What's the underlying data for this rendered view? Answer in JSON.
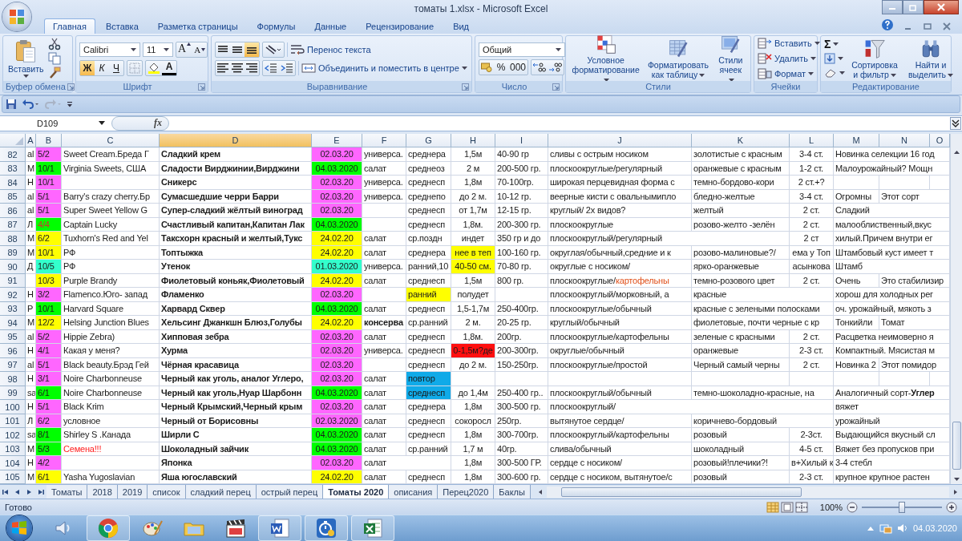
{
  "window": {
    "title": "томаты 1.xlsx - Microsoft Excel"
  },
  "ribbon_tabs": [
    {
      "label": "Главная",
      "selected": true
    },
    {
      "label": "Вставка",
      "selected": false
    },
    {
      "label": "Разметка страницы",
      "selected": false
    },
    {
      "label": "Формулы",
      "selected": false
    },
    {
      "label": "Данные",
      "selected": false
    },
    {
      "label": "Рецензирование",
      "selected": false
    },
    {
      "label": "Вид",
      "selected": false
    }
  ],
  "ribbon": {
    "clipboard": {
      "paste": "Вставить",
      "label": "Буфер обмена"
    },
    "font": {
      "name": "Calibri",
      "size": "11",
      "grow": "A",
      "shrink": "A",
      "styles": [
        {
          "glyph": "Ж",
          "on": true
        },
        {
          "glyph": "К",
          "on": false
        },
        {
          "glyph": "Ч",
          "on": false
        }
      ],
      "color_glyph": "A",
      "label": "Шрифт"
    },
    "alignment": {
      "vertical": [
        {
          "on": false
        },
        {
          "on": false
        },
        {
          "on": true
        }
      ],
      "wrap": "Перенос текста",
      "merge": "Объединить и поместить в центре",
      "label": "Выравнивание"
    },
    "number": {
      "format": "Общий",
      "percent": "%",
      "thousands": "000",
      "label": "Число"
    },
    "styles": {
      "buttons": [
        "Условное форматирование",
        "Форматировать как таблицу",
        "Стили ячеек"
      ],
      "label": "Стили"
    },
    "cells": {
      "buttons": [
        "Вставить",
        "Удалить",
        "Формат"
      ],
      "label": "Ячейки"
    },
    "editing": {
      "sum": "Σ",
      "buttons": [
        "Сортировка и фильтр",
        "Найти и выделить"
      ],
      "label": "Редактирование"
    }
  },
  "formula_bar": {
    "name_box": "D109",
    "fx": "fx"
  },
  "sheet": {
    "columns": [
      {
        "letter": "A",
        "selected": false
      },
      {
        "letter": "B",
        "selected": false
      },
      {
        "letter": "C",
        "selected": false
      },
      {
        "letter": "D",
        "selected": true,
        "bold": true
      },
      {
        "letter": "E",
        "selected": false
      },
      {
        "letter": "F",
        "selected": false
      },
      {
        "letter": "G",
        "selected": false
      },
      {
        "letter": "H",
        "selected": false
      },
      {
        "letter": "I",
        "selected": false
      },
      {
        "letter": "J",
        "selected": false
      },
      {
        "letter": "K",
        "selected": false
      },
      {
        "letter": "L",
        "selected": false
      },
      {
        "letter": "M",
        "selected": false
      },
      {
        "letter": "N",
        "selected": false
      },
      {
        "letter": "O",
        "selected": false
      }
    ],
    "rows": [
      {
        "number": "82",
        "cells": [
          "al",
          {
            "text": "5/2",
            "color": "#ff66ff"
          },
          "Sweet Cream.Бреда Г",
          "Сладкий крем",
          {
            "text": "02.03.20",
            "color": "#ff66ff"
          },
          "универса.",
          "среднера",
          "1,5м",
          "40-90 гр",
          "сливы с острым носиком",
          "золотистые с красным",
          "3-4 ст.",
          "Новинка селекции 16 год",
          ""
        ]
      },
      {
        "number": "83",
        "cells": [
          "M",
          {
            "text": "10/1",
            "color": "#00ff00"
          },
          "Virginia Sweets, США",
          "Сладости Вирджинии,Вирджини",
          {
            "text": "04.03.2020",
            "color": "#00ff00"
          },
          "салат",
          "среднеоз",
          "2 м",
          "200-500 гр.",
          "плоскоокруглые/регулярный",
          "оранжевые с красным",
          "1-2 ст.",
          "Малоурожайный? Мощн",
          ""
        ]
      },
      {
        "number": "84",
        "cells": [
          "H",
          {
            "text": "10/1",
            "color": "#ff66ff"
          },
          "",
          "Сникерс",
          {
            "text": "02.03.20",
            "color": "#ff66ff"
          },
          "универса.",
          "среднесп",
          "1,8м",
          "70-100гр.",
          "широкая перцевидная форма с",
          "темно-бордово-кори",
          "2 ст.+?",
          "",
          ""
        ]
      },
      {
        "number": "85",
        "cells": [
          "al",
          {
            "text": "5/1",
            "color": "#ff66ff"
          },
          "Barry's crazy cherry.Бр",
          "Сумасшедшие черри Барри",
          {
            "text": "02.03.20",
            "color": "#ff66ff"
          },
          "универса.",
          "среднепо",
          "до 2 м.",
          "10-12 гр.",
          "веерные кисти с овальнымипло",
          "бледно-желтые",
          "3-4 ст.",
          "Огромны",
          "Этот сорт"
        ]
      },
      {
        "number": "86",
        "cells": [
          "al",
          {
            "text": "5/1",
            "color": "#ff66ff"
          },
          "Super Sweet Yellow G",
          "Супер-сладкий жёлтый виноград",
          {
            "text": "02.03.20",
            "color": "#ff66ff"
          },
          "",
          "среднесп",
          "от 1,7м",
          "12-15 гр.",
          "круглый/ 2х видов?",
          "желтый",
          "2 ст.",
          "Сладкий",
          ""
        ]
      },
      {
        "number": "87",
        "cells": [
          "Л",
          {
            "text": "4/4",
            "color": "#00ff00",
            "ink": {
              "color": "#d03030"
            }
          },
          "Captain Lucky",
          "Счастливый капитан,Капитан Лак",
          {
            "text": "04.03.2020",
            "color": "#00ff00"
          },
          "",
          "среднесп",
          "1,8м.",
          "200-300 гр.",
          "плоскоокруглые",
          "розово-желто -зелён",
          "2 ст.",
          "малооблиственный,вкус",
          ""
        ]
      },
      {
        "number": "88",
        "cells": [
          "M",
          {
            "text": "6/2",
            "color": "#ffff00"
          },
          "Tuxhorn's Red and Yel",
          "Таксхорн красный и желтый,Тукс",
          {
            "text": "24.02.20",
            "color": "#ffff00"
          },
          "салат",
          "ср.поздн",
          "индет",
          "350 гр и до",
          "плоскоокруглый/регулярный",
          "",
          "2 ст",
          "хилый.Причем внутри ег",
          ""
        ]
      },
      {
        "number": "89",
        "cells": [
          "M",
          {
            "text": "10/1",
            "color": "#ffff00"
          },
          "РФ",
          "Топтыжка",
          {
            "text": "24.02.20",
            "color": "#ffff00"
          },
          "салат",
          "среднера",
          {
            "text": "нее в теп",
            "color": "#ffff00"
          },
          "100-160 гр.",
          "округлая/обычный,средние и к",
          "розово-малиновые?/",
          "ема у Топ",
          "Штамбовый куст имеет т",
          ""
        ]
      },
      {
        "number": "90",
        "cells": [
          "Д",
          {
            "text": "10/5",
            "color": "#33ffcc"
          },
          "РФ",
          "Утенок",
          {
            "text": "01.03.2020",
            "color": "#33ffcc"
          },
          "универса.",
          "ранний,10",
          {
            "text": "40-50 см.",
            "color": "#ffff00"
          },
          "70-80 гр.",
          "округлые с носиком/",
          "ярко-оранжевые",
          "асынкова",
          "Штамб",
          ""
        ]
      },
      {
        "number": "91",
        "cells": [
          "",
          {
            "text": "10/3",
            "color": "#ffff00"
          },
          "Purple Brandy",
          "Фиолетовый коньяк,Фиолетовый",
          {
            "text": "24.02.20",
            "color": "#ffff00"
          },
          "салат",
          "среднесп",
          "1,5м",
          "800 гр.",
          {
            "runs": [
              {
                "text": "плоскоокруглые/"
              },
              {
                "text": "картофельны",
                "color": "#e0501a"
              }
            ]
          },
          "темно-розового  цвет",
          "2 ст.",
          "Очень",
          "Это стабилизир"
        ]
      },
      {
        "number": "92",
        "cells": [
          "H",
          {
            "text": "3/2",
            "color": "#ff66ff"
          },
          "Flamenco.Юго- запад",
          "Фламенко",
          {
            "text": "02.03.20",
            "color": "#ff66ff"
          },
          "",
          {
            "text": "ранний",
            "color": "#ffff00"
          },
          "полудет",
          "",
          "плоскоокруглый/морковный, а",
          "красные",
          "",
          "хорош для холодных рег",
          ""
        ]
      },
      {
        "number": "93",
        "cells": [
          "P",
          {
            "text": "10/1",
            "color": "#00ff00"
          },
          "Harvard Square",
          "Харвард Сквер",
          {
            "text": "04.03.2020",
            "color": "#00ff00"
          },
          "салат",
          "среднесп",
          "1,5-1,7м",
          "250-400гр.",
          "плоскоокруглые/обычный",
          "красные с зелеными полосками",
          "",
          "оч. урожайный, мякоть з",
          ""
        ]
      },
      {
        "number": "94",
        "cells": [
          "M",
          {
            "text": "12/2",
            "color": "#ffff00"
          },
          "Helsing Junction Blues",
          "Хельсинг Джанкшн Блюз,Голубы",
          {
            "text": "24.02.20",
            "color": "#ffff00"
          },
          {
            "text": "консерва",
            "bold": true
          },
          "ср.ранний",
          "2 м.",
          "20-25 гр.",
          "круглый/обычный",
          "фиолетовые, почти черные с кр",
          "",
          "Тонкийли",
          "Томат"
        ]
      },
      {
        "number": "95",
        "cells": [
          "al",
          {
            "text": "5/2",
            "color": "#ff66ff"
          },
          "Hippie Zebra)",
          "Хипповая зебра",
          {
            "text": "02.03.20",
            "color": "#ff66ff"
          },
          "салат",
          "среднесп",
          "1,8м.",
          "200гр.",
          "плоскоокруглые/картофельны",
          "зеленые с красными",
          "2 ст.",
          "Расцветка неимоверно я",
          ""
        ]
      },
      {
        "number": "96",
        "cells": [
          "H",
          {
            "text": "4/1",
            "color": "#ff66ff"
          },
          "Какая у меня?",
          "Хурма",
          {
            "text": "02.03.20",
            "color": "#ff66ff"
          },
          "универса.",
          "среднесп",
          {
            "text": "0-1,5м?де",
            "color": "#ff1010"
          },
          "200-300гр.",
          "округлые/обычный",
          "оранжевые",
          "2-3 ст.",
          "Компактный. Мясистая м",
          ""
        ]
      },
      {
        "number": "97",
        "cells": [
          "al",
          {
            "text": "5/1",
            "color": "#ff66ff"
          },
          "Black beauty.Брэд Гей",
          "Чёрная красавица",
          {
            "text": "02.03.20",
            "color": "#ff66ff"
          },
          "",
          "среднесп",
          "до 2 м.",
          "150-250гр.",
          "плоскоокруглые/простой",
          "Черный самый черны",
          "2 ст.",
          "Новинка 2",
          "Этот помидор"
        ]
      },
      {
        "number": "98",
        "cells": [
          "H",
          {
            "text": "3/1",
            "color": "#ff66ff"
          },
          "Noire Charbonneuse",
          "Черный как уголь, аналог Углеро,",
          {
            "text": "02.03.20",
            "color": "#ff66ff"
          },
          "салат",
          {
            "text": "повтор",
            "color": "#10aae8"
          },
          "",
          "",
          "",
          "",
          "",
          "",
          ""
        ]
      },
      {
        "number": "99",
        "cells": [
          "sa",
          {
            "text": "6/1",
            "color": "#00ff00"
          },
          "Noire Charbonneuse",
          "Черный как уголь,Нуар Шарбонн",
          {
            "text": "04.03.2020",
            "color": "#00ff00"
          },
          "салат",
          {
            "text": "среднесп",
            "color": "#10aae8"
          },
          "до 1,4м",
          "250-400 гр..",
          "плоскоокруглый/обычный",
          "темно-шоколадно-красные, на",
          "",
          "Аналогичный сорт-**Углер**",
          ""
        ]
      },
      {
        "number": "100",
        "cells": [
          "H",
          {
            "text": "5/1",
            "color": "#ff66ff"
          },
          "Black Krim",
          "Черный Крымский,Черный крым",
          {
            "text": "02.03.20",
            "color": "#ff66ff"
          },
          "салат",
          "среднера",
          "1,8м",
          "300-500 гр.",
          "плоскоокруглый/",
          "",
          "",
          "вяжет",
          ""
        ]
      },
      {
        "number": "101",
        "cells": [
          "Л",
          {
            "text": "6/2",
            "color": "#ff66ff"
          },
          "условное",
          "Черный от Борисовны",
          {
            "text": "02.03.2020",
            "color": "#ff66ff"
          },
          "салат",
          "среднесп",
          "сокоросл",
          "250гр.",
          "вытянутое сердце/",
          "коричнево-бордовый",
          "",
          "урожайный",
          ""
        ]
      },
      {
        "number": "102",
        "cells": [
          "sa",
          {
            "text": "8/1",
            "color": "#00ff00"
          },
          "Shirley S .Канада",
          "Ширли С",
          {
            "text": "04.03.2020",
            "color": "#00ff00"
          },
          "салат",
          "среднесп",
          "1,8м",
          "300-700гр.",
          "плоскоокруглый/картофельны",
          "розовый",
          "2-3ст.",
          "Выдающийся вкусный сл",
          ""
        ]
      },
      {
        "number": "103",
        "cells": [
          "M",
          {
            "text": "5/3",
            "color": "#00ff00"
          },
          {
            "text": "Семена!!!",
            "ink": {
              "color": "#ff2020"
            }
          },
          "Шоколадный зайчик",
          {
            "text": "04.03.2020",
            "color": "#00ff00"
          },
          "салат",
          "ср.ранний",
          "1,7 м",
          "40гр.",
          "слива/обычный",
          "шоколадный",
          "4-5 ст.",
          "Вяжет без пропусков при",
          ""
        ]
      },
      {
        "number": "104",
        "cells": [
          "H",
          {
            "text": "4/2",
            "color": "#ff66ff"
          },
          "",
          "Японка",
          {
            "text": "02.03.20",
            "color": "#ff66ff"
          },
          "салат",
          "",
          "1,8м",
          "300-500 ГР.",
          "сердце с носиком/",
          "розовый!плечики?!",
          "в+Хилый к",
          "3-4 стебл",
          ""
        ]
      },
      {
        "number": "105",
        "cells": [
          "M",
          {
            "text": "6/1",
            "color": "#ffff00"
          },
          "Yasha Yugoslavian",
          "Яша югославский",
          {
            "text": "24.02.20",
            "color": "#ffff00"
          },
          "салат",
          "среднесп",
          "1,8м",
          "300-600 гр.",
          "сердце с носиком, вытянутое/с",
          "розовый",
          "2-3 ст.",
          "крупное крупное растен",
          ""
        ]
      }
    ]
  },
  "sheet_tabs": [
    {
      "label": "Томаты",
      "selected": false
    },
    {
      "label": "2018",
      "selected": false
    },
    {
      "label": "2019",
      "selected": false
    },
    {
      "label": "список",
      "selected": false
    },
    {
      "label": "сладкий перец",
      "selected": false
    },
    {
      "label": "острый перец",
      "selected": false
    },
    {
      "label": "Томаты 2020",
      "selected": true
    },
    {
      "label": "описания",
      "selected": false
    },
    {
      "label": "Перец2020",
      "selected": false
    },
    {
      "label": "Баклы",
      "selected": false
    }
  ],
  "status_bar": {
    "text": "Готово",
    "zoom": "100%",
    "zoom_slider": {
      "level": 0.5
    }
  },
  "taskbar": {
    "date": "04.03.2020"
  }
}
